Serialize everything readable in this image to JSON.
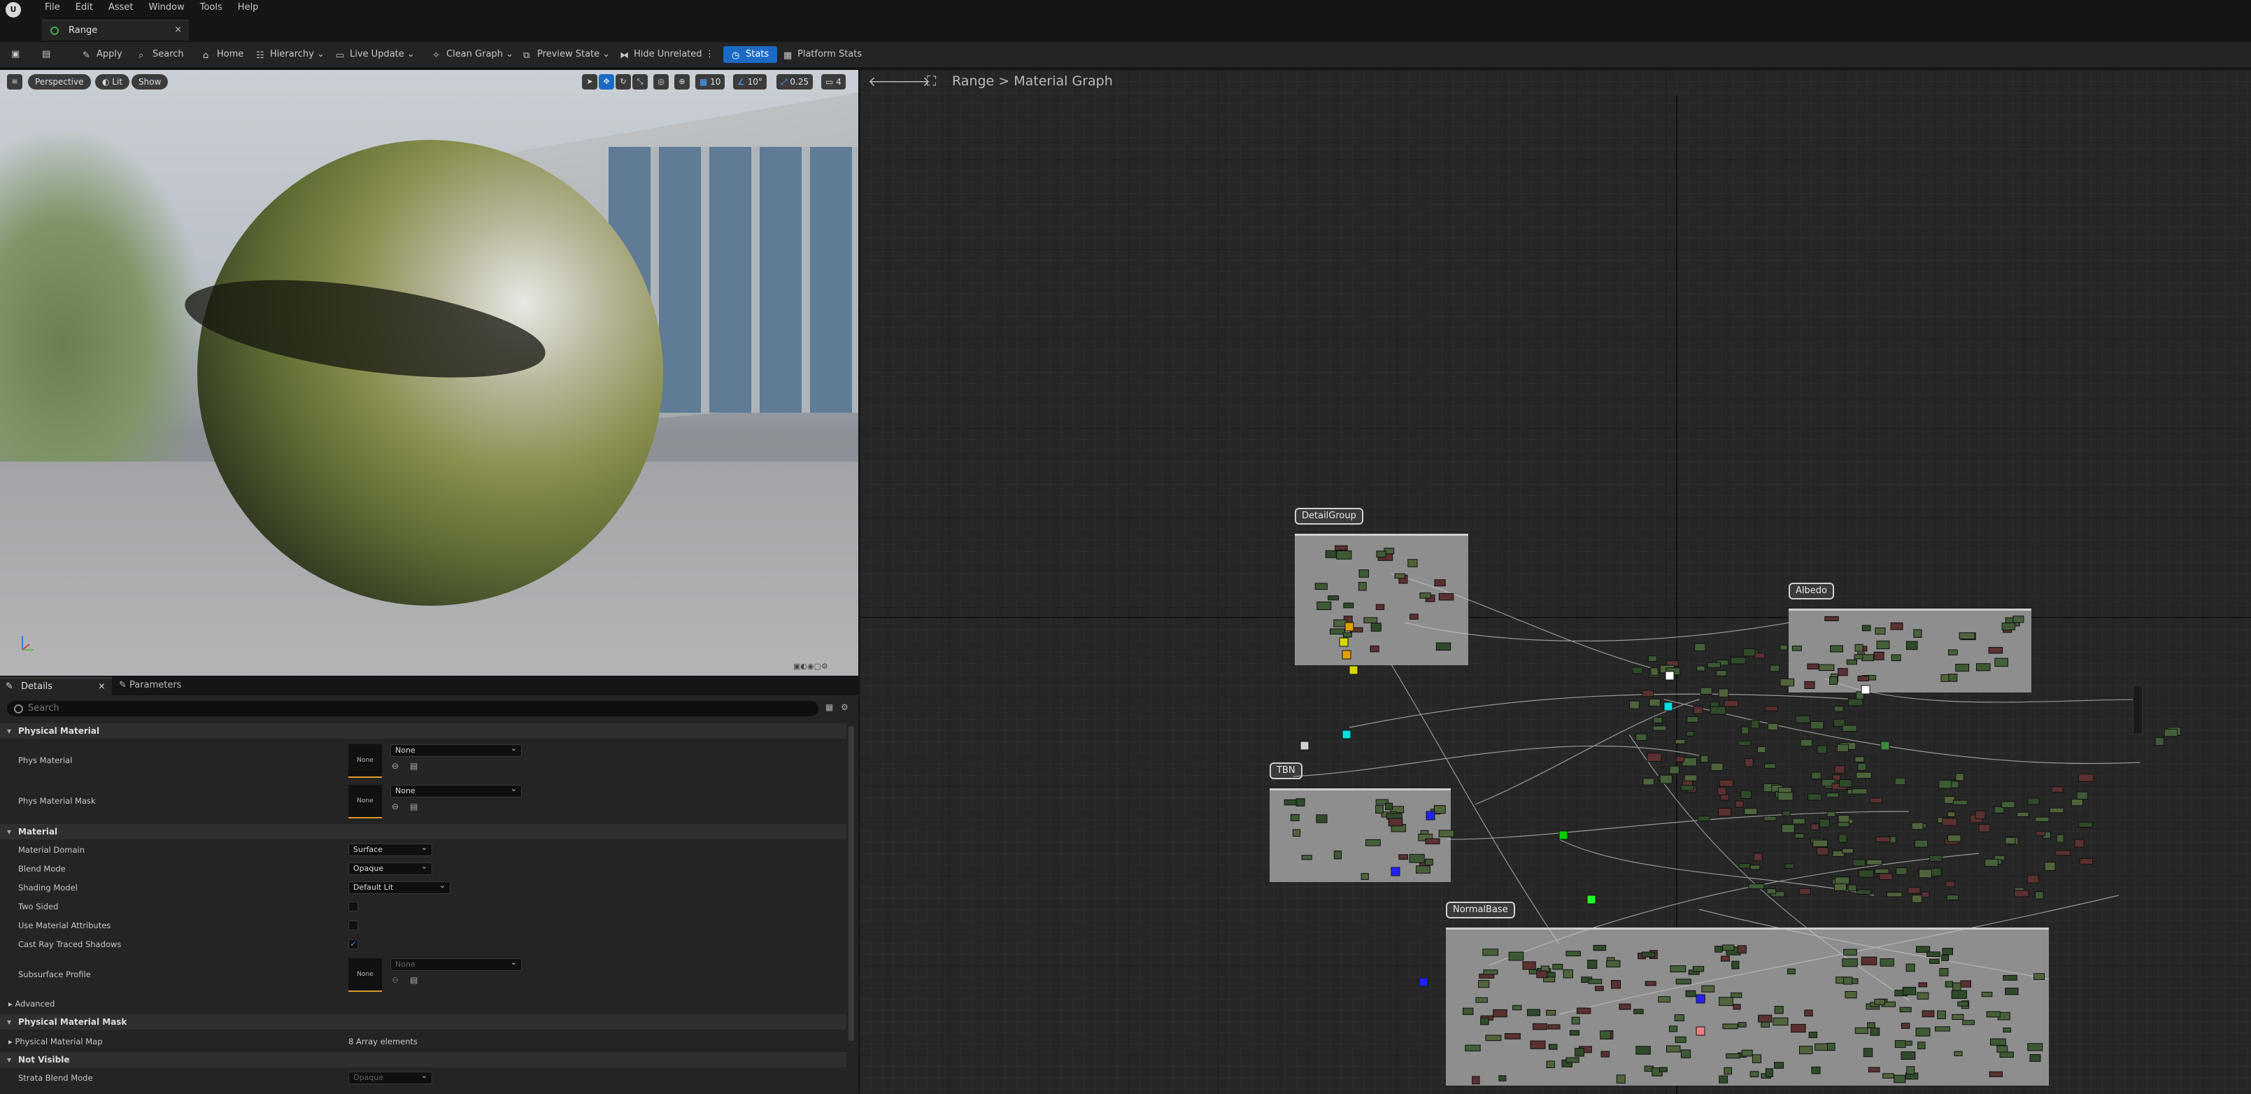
{
  "menubar": {
    "items": [
      "File",
      "Edit",
      "Asset",
      "Window",
      "Tools",
      "Help"
    ]
  },
  "tab": {
    "title": "Range",
    "close": "×"
  },
  "toolbar": {
    "apply": "Apply",
    "search": "Search",
    "home": "Home",
    "hierarchy": "Hierarchy",
    "live_update": "Live Update",
    "clean_graph": "Clean Graph",
    "preview_state": "Preview State",
    "hide_unrelated": "Hide Unrelated",
    "stats": "Stats",
    "platform_stats": "Platform Stats"
  },
  "viewport": {
    "perspective": "Perspective",
    "lit": "Lit",
    "show": "Show",
    "grid_snap": "10",
    "rotation_snap": "10°",
    "scale_snap": "0.25",
    "camera_speed": "4"
  },
  "details": {
    "tab_details": "Details",
    "tab_parameters": "Parameters",
    "search_placeholder": "Search",
    "sections": {
      "physical_material": "Physical Material",
      "material": "Material",
      "advanced": "Advanced",
      "physical_material_mask": "Physical Material Mask",
      "not_visible": "Not Visible"
    },
    "props": {
      "phys_material": "Phys Material",
      "phys_material_mask": "Phys Material Mask",
      "material_domain": "Material Domain",
      "blend_mode": "Blend Mode",
      "shading_model": "Shading Model",
      "two_sided": "Two Sided",
      "use_material_attributes": "Use Material Attributes",
      "cast_ray_traced_shadows": "Cast Ray Traced Shadows",
      "subsurface_profile": "Subsurface Profile",
      "physical_material_map": "Physical Material Map",
      "strata_blend_mode": "Strata Blend Mode"
    },
    "values": {
      "none": "None",
      "material_domain": "Surface",
      "blend_mode": "Opaque",
      "shading_model": "Default Lit",
      "physical_material_map": "8 Array elements",
      "strata_blend_mode": "Opaque"
    },
    "checks": {
      "two_sided": false,
      "use_material_attributes": false,
      "cast_ray_traced_shadows": true
    }
  },
  "graph": {
    "breadcrumb_root": "Range",
    "breadcrumb_sep": ">",
    "breadcrumb_leaf": "Material Graph",
    "comments": [
      "DetailGroup",
      "Albedo",
      "TBN",
      "NormalBase"
    ]
  }
}
